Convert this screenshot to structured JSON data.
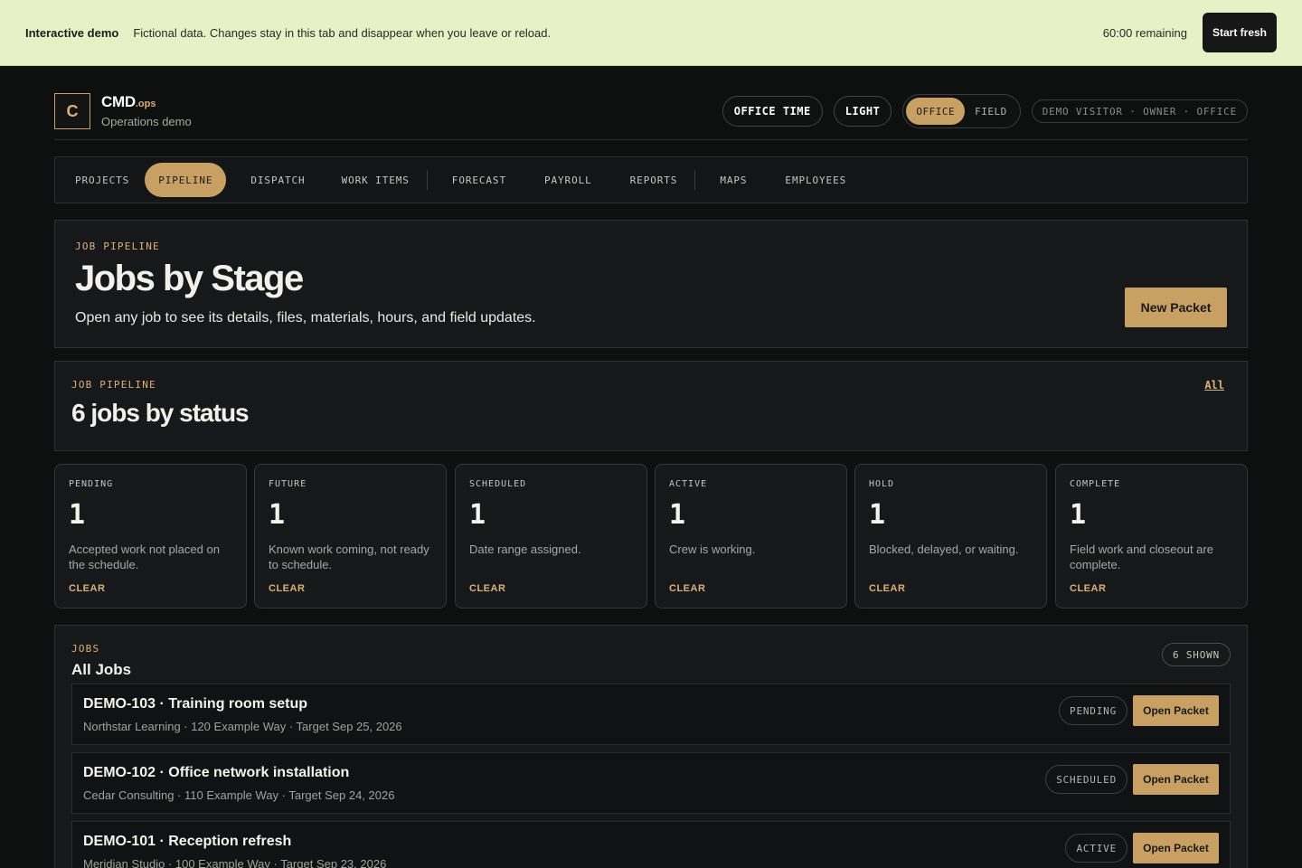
{
  "banner": {
    "tag": "Interactive demo",
    "message": "Fictional data. Changes stay in this tab and disappear when you leave or reload.",
    "timer": "60:00 remaining",
    "reset_label": "Start fresh"
  },
  "header": {
    "logo_letter": "C",
    "brand_name": "CMD",
    "brand_suffix": ".ops",
    "subtitle": "Operations demo",
    "office_time_label": "OFFICE TIME",
    "theme_label": "LIGHT",
    "mode_options": [
      "OFFICE",
      "FIELD"
    ],
    "mode_selected": "OFFICE",
    "visitor_label": "DEMO VISITOR · OWNER · OFFICE"
  },
  "nav": {
    "items": [
      "PROJECTS",
      "PIPELINE",
      "DISPATCH",
      "WORK ITEMS",
      "FORECAST",
      "PAYROLL",
      "REPORTS",
      "MAPS",
      "EMPLOYEES"
    ],
    "active": "PIPELINE"
  },
  "hero": {
    "eyebrow": "JOB PIPELINE",
    "title": "Jobs by Stage",
    "description": "Open any job to see its details, files, materials, hours, and field updates.",
    "button_label": "New Packet"
  },
  "status": {
    "eyebrow": "JOB PIPELINE",
    "title": "6 jobs by status",
    "all_link": "All",
    "cards": [
      {
        "label": "PENDING",
        "count": "1",
        "text": "Accepted work not placed on the schedule.",
        "clear": "CLEAR"
      },
      {
        "label": "FUTURE",
        "count": "1",
        "text": "Known work coming, not ready to schedule.",
        "clear": "CLEAR"
      },
      {
        "label": "SCHEDULED",
        "count": "1",
        "text": "Date range assigned.",
        "clear": "CLEAR"
      },
      {
        "label": "ACTIVE",
        "count": "1",
        "text": "Crew is working.",
        "clear": "CLEAR"
      },
      {
        "label": "HOLD",
        "count": "1",
        "text": "Blocked, delayed, or waiting.",
        "clear": "CLEAR"
      },
      {
        "label": "COMPLETE",
        "count": "1",
        "text": "Field work and closeout are complete.",
        "clear": "CLEAR"
      }
    ]
  },
  "jobs": {
    "eyebrow": "JOBS",
    "title": "All Jobs",
    "shown_label": "6 SHOWN",
    "rows": [
      {
        "title": "DEMO-103 · Training room setup",
        "meta": "Northstar Learning · 120 Example Way · Target Sep 25, 2026",
        "status": "PENDING",
        "action": "Open Packet"
      },
      {
        "title": "DEMO-102 · Office network installation",
        "meta": "Cedar Consulting · 110 Example Way · Target Sep 24, 2026",
        "status": "SCHEDULED",
        "action": "Open Packet"
      },
      {
        "title": "DEMO-101 · Reception refresh",
        "meta": "Meridian Studio · 100 Example Way · Target Sep 23, 2026",
        "status": "ACTIVE",
        "action": "Open Packet"
      }
    ]
  },
  "colors": {
    "accent": "#c9a063",
    "banner_bg": "#e8f0c6",
    "page_bg": "#0e0f0f"
  }
}
